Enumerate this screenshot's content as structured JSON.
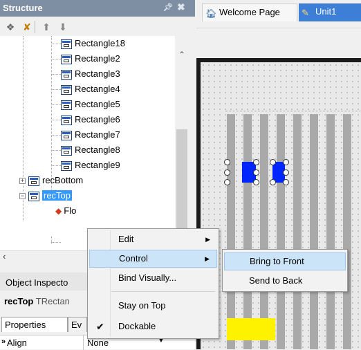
{
  "structure": {
    "title": "Structure",
    "pin_icon": "pin-icon",
    "close_icon": "close-icon",
    "tree": {
      "items": [
        {
          "label": "Rectangle18"
        },
        {
          "label": "Rectangle2"
        },
        {
          "label": "Rectangle3"
        },
        {
          "label": "Rectangle4"
        },
        {
          "label": "Rectangle5"
        },
        {
          "label": "Rectangle6"
        },
        {
          "label": "Rectangle7"
        },
        {
          "label": "Rectangle8"
        },
        {
          "label": "Rectangle9"
        },
        {
          "label": "recBottom"
        },
        {
          "label": "recTop"
        },
        {
          "label": "Flo"
        }
      ]
    }
  },
  "object_inspector": {
    "title": "Object Inspecto",
    "object_name": "recTop",
    "object_type": "TRectan",
    "tabs": [
      "Properties",
      "Ev"
    ],
    "row": {
      "name": "Align",
      "value": "None"
    }
  },
  "designer": {
    "tabs": [
      {
        "label": "Welcome Page",
        "active": false
      },
      {
        "label": "Unit1",
        "active": true
      }
    ]
  },
  "context_menu": {
    "items": [
      {
        "label": "Edit",
        "has_submenu": true
      },
      {
        "label": "Control",
        "has_submenu": true,
        "highlighted": true
      },
      {
        "label": "Bind Visually...",
        "has_submenu": false
      },
      {
        "label": "Stay on Top",
        "has_submenu": false
      },
      {
        "label": "Dockable",
        "has_submenu": false,
        "checked": true
      }
    ]
  },
  "submenu": {
    "items": [
      {
        "label": "Bring to Front",
        "highlighted": true
      },
      {
        "label": "Send to Back"
      }
    ]
  },
  "colors": {
    "header_bg": "#7f8fa3",
    "selection": "#3399ff",
    "active_tab": "#3d7fd6",
    "menu_highlight": "#cce4f7",
    "blue_rect": "#0026ff",
    "yellow_rect": "#fff200"
  }
}
